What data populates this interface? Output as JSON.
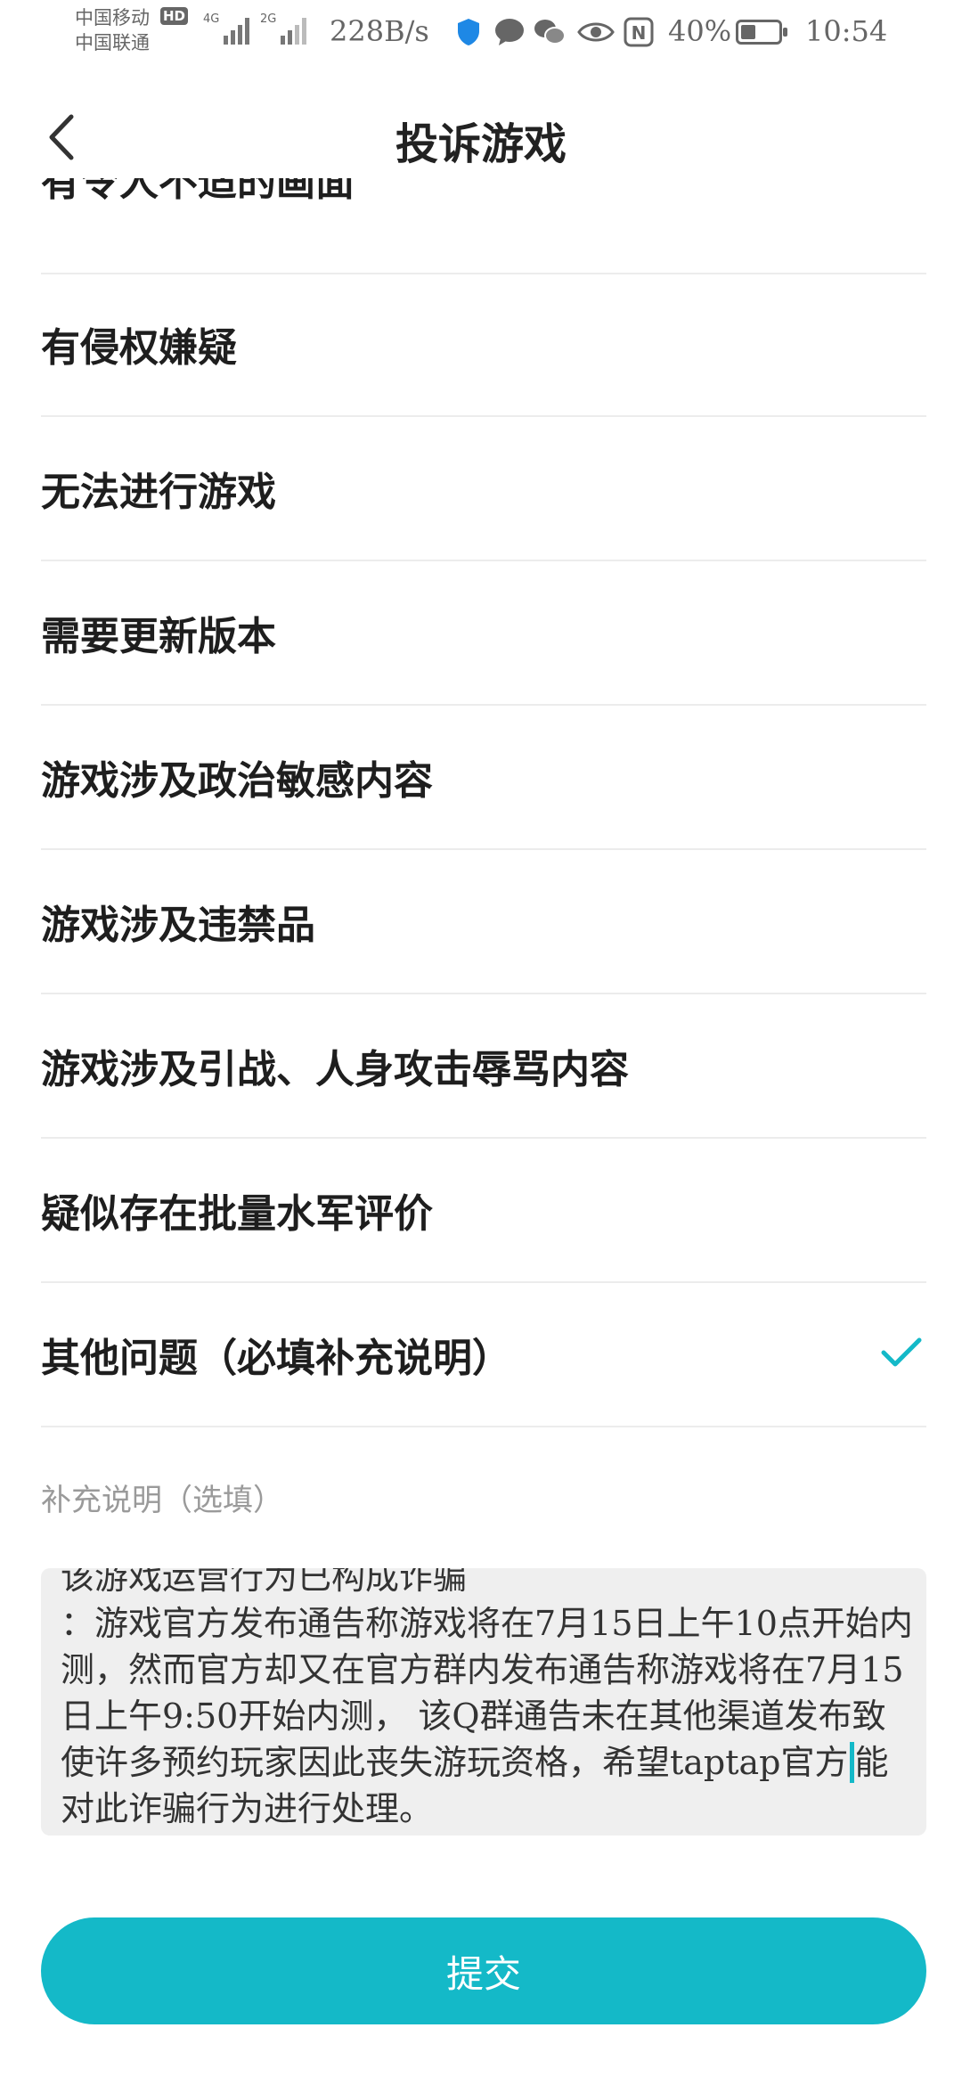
{
  "status_bar": {
    "carrier_1": "中国移动",
    "carrier_2": "中国联通",
    "hd_badge": "HD",
    "signal_1_label": "4G",
    "signal_2_label": "2G",
    "net_speed": "228B/s",
    "battery_percent": "40%",
    "battery_level": 0.4,
    "time": "10:54",
    "nfc_label": "N"
  },
  "header": {
    "title": "投诉游戏"
  },
  "list": {
    "partial_item": "有令人不适的画面",
    "items": [
      "有侵权嫌疑",
      "无法进行游戏",
      "需要更新版本",
      "游戏涉及政治敏感内容",
      "游戏涉及违禁品",
      "游戏涉及引战、人身攻击辱骂内容",
      "疑似存在批量水军评价",
      "其他问题（必填补充说明）"
    ],
    "selected_index": 7
  },
  "supplement": {
    "label": "补充说明（选填）",
    "text_before_cursor": "该游戏运营行为已构成诈骗\n：游戏官方发布通告称游戏将在7月15日上午10点开始内测，然而官方却又在官方群内发布通告称游戏将在7月15日上午9:50开始内测， 该Q群通告未在其他渠道发布致使许多预约玩家因此丧失游玩资格，希望taptap官方",
    "text_after_cursor": "能对此诈骗行为进行处理。"
  },
  "submit": {
    "label": "提交"
  },
  "colors": {
    "accent": "#14b9c8",
    "divider": "#ececec",
    "textarea_bg": "#efefef"
  }
}
